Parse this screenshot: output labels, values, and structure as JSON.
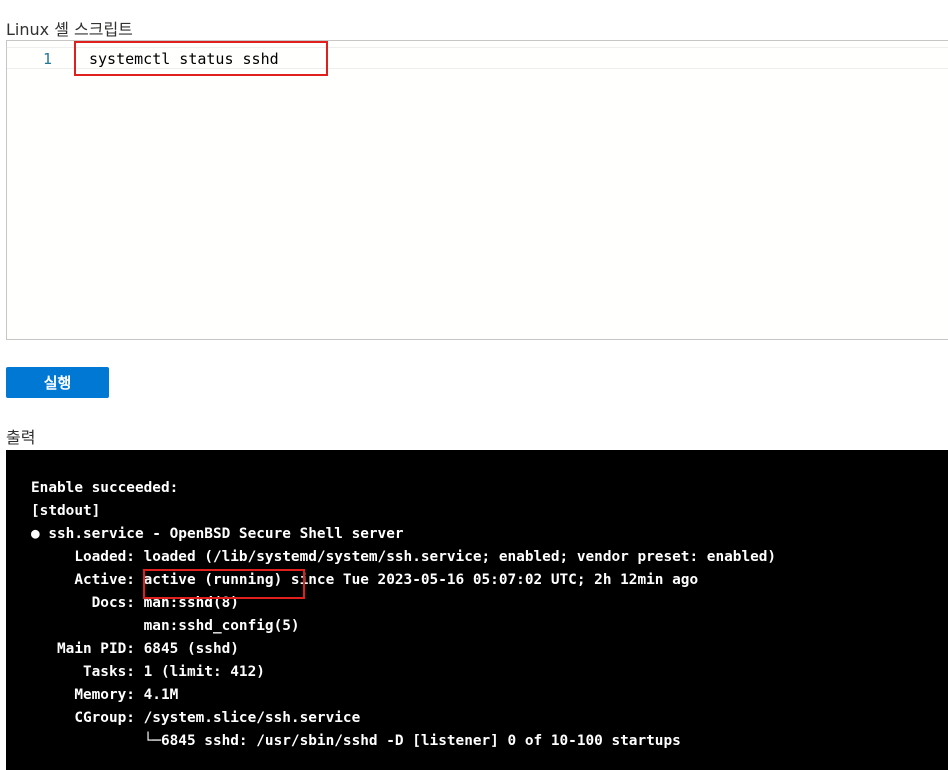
{
  "script_panel": {
    "label": "Linux 셸 스크립트",
    "line_number": "1",
    "code": "systemctl status sshd"
  },
  "run_button": {
    "label": "실행"
  },
  "output_panel": {
    "label": "출력",
    "lines": [
      "Enable succeeded:",
      "[stdout]",
      "● ssh.service - OpenBSD Secure Shell server",
      "     Loaded: loaded (/lib/systemd/system/ssh.service; enabled; vendor preset: enabled)",
      "     Active: active (running) since Tue 2023-05-16 05:07:02 UTC; 2h 12min ago",
      "       Docs: man:sshd(8)",
      "             man:sshd_config(5)",
      "   Main PID: 6845 (sshd)",
      "      Tasks: 1 (limit: 412)",
      "     Memory: 4.1M",
      "     CGroup: /system.slice/ssh.service",
      "             └─6845 sshd: /usr/sbin/sshd -D [listener] 0 of 10-100 startups"
    ]
  },
  "colors": {
    "highlight": "#e01f1f",
    "button": "#0078d4",
    "terminal_bg": "#000000"
  }
}
